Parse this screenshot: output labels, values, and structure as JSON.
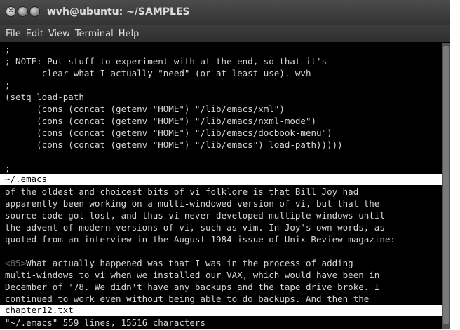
{
  "window": {
    "title": "wvh@ubuntu: ~/SAMPLES",
    "buttons": {
      "close": "✕",
      "minimize": "",
      "maximize": ""
    }
  },
  "menu": [
    "File",
    "Edit",
    "View",
    "Terminal",
    "Help"
  ],
  "top_buffer": {
    "lines": [
      ";",
      "; NOTE: Put stuff to experiment with at the end, so that it's",
      "       clear what I actually \"need\" (or at least use). wvh",
      ";",
      "(setq load-path",
      "      (cons (concat (getenv \"HOME\") \"/lib/emacs/xml\")",
      "      (cons (concat (getenv \"HOME\") \"/lib/emacs/nxml-mode\")",
      "      (cons (concat (getenv \"HOME\") \"/lib/emacs/docbook-menu\")",
      "      (cons (concat (getenv \"HOME\") \"/lib/emacs\") load-path)))))",
      "",
      "",
      ";"
    ],
    "filename": "~/.emacs"
  },
  "bottom_buffer": {
    "lines": [
      "of the oldest and choicest bits of vi folklore is that Bill Joy had",
      "apparently been working on a multi-windowed version of vi, but that the",
      "source code got lost, and thus vi never developed multiple windows until",
      "the advent of modern versions of vi, such as vim. In Joy's own words, as",
      "quoted from an interview in the August 1984 issue of Unix Review magazine:",
      ""
    ],
    "quote_marker": "<85>",
    "quote_lines": [
      "What actually happened was that I was in the process of adding",
      "multi-windows to vi when we installed our VAX, which would have been in",
      "December of '78. We didn't have any backups and the tape drive broke. I",
      "continued to work even without being able to do backups. And then the"
    ],
    "filename": "chapter12.txt"
  },
  "message_line": "\"~/.emacs\" 559 lines, 15516 characters"
}
